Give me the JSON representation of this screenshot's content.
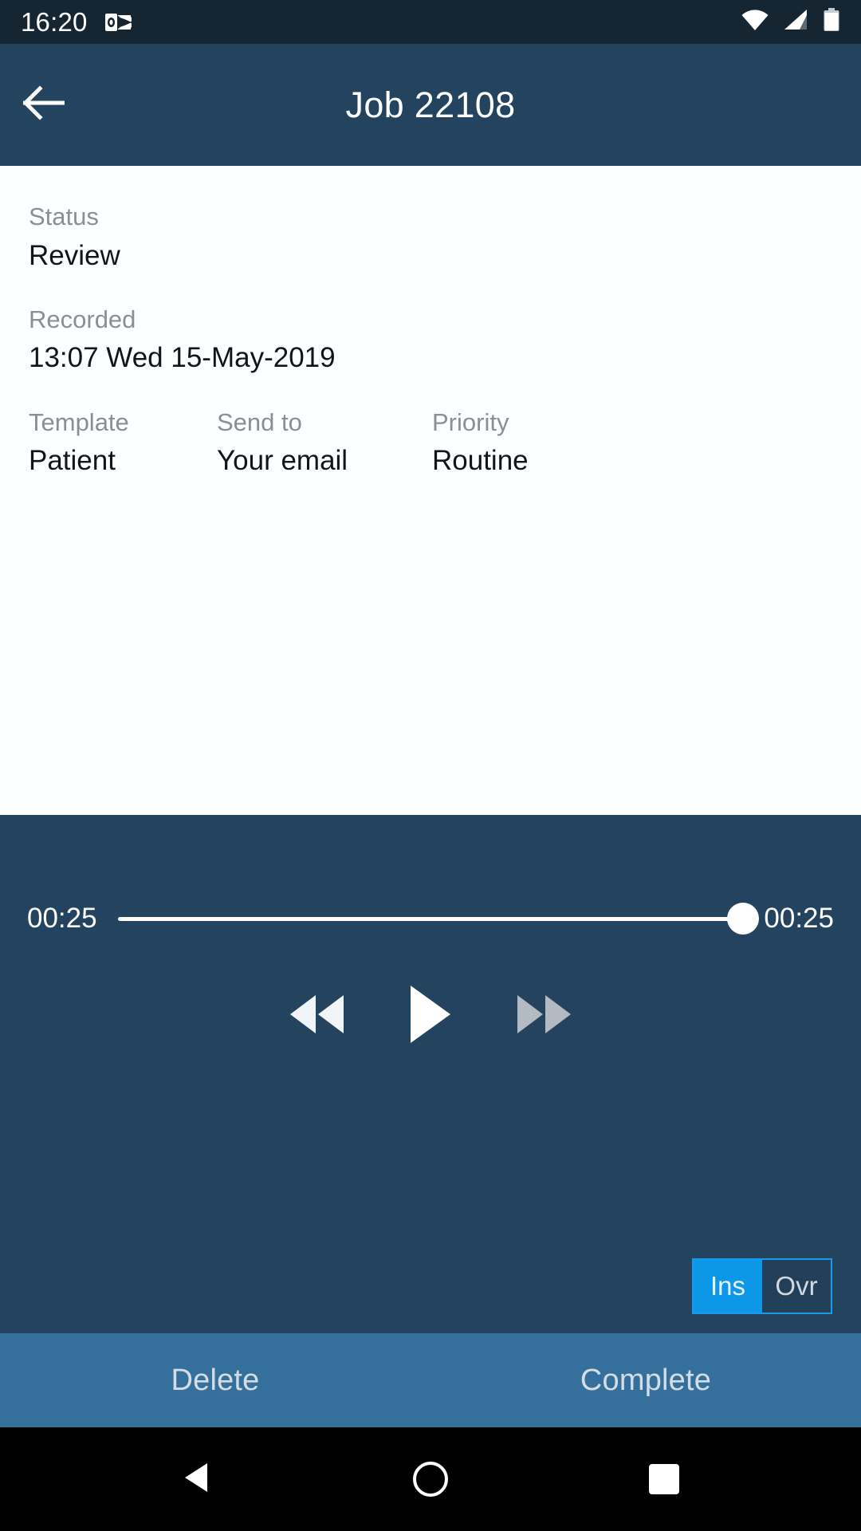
{
  "status_bar": {
    "clock": "16:20",
    "icons": [
      "outlook-icon",
      "wifi-icon",
      "cellular-signal-icon",
      "battery-icon"
    ]
  },
  "app_bar": {
    "back_icon": "arrow-left-icon",
    "title": "Job 22108"
  },
  "details": {
    "status": {
      "label": "Status",
      "value": "Review"
    },
    "recorded": {
      "label": "Recorded",
      "value": "13:07 Wed 15-May-2019"
    },
    "row": [
      {
        "label": "Template",
        "value": "Patient"
      },
      {
        "label": "Send to",
        "value": "Your email"
      },
      {
        "label": "Priority",
        "value": "Routine"
      }
    ]
  },
  "player": {
    "elapsed": "00:25",
    "duration": "00:25",
    "progress_percent": 100,
    "controls": [
      {
        "name": "rewind-button",
        "icon": "rewind-icon",
        "state": "enabled"
      },
      {
        "name": "play-button",
        "icon": "play-icon",
        "state": "enabled"
      },
      {
        "name": "fast-forward-button",
        "icon": "fast-forward-icon",
        "state": "disabled"
      }
    ],
    "mode_toggle": {
      "insert_label": "Ins",
      "overwrite_label": "Ovr",
      "selected": "Ins"
    }
  },
  "action_bar": {
    "delete_label": "Delete",
    "complete_label": "Complete"
  },
  "nav_bar": {
    "back": "triangle-back-icon",
    "home": "circle-home-icon",
    "recents": "square-recents-icon"
  },
  "colors": {
    "status_bar_bg": "#152532",
    "app_bar_bg": "#24435e",
    "panel_bg": "#fdfeff",
    "player_bg": "#24435e",
    "action_bar_bg": "#35709c",
    "accent_blue": "#0d97e8",
    "nav_bar_bg": "#000000",
    "label_grey": "#8a8f94",
    "value_dark": "#121417"
  }
}
